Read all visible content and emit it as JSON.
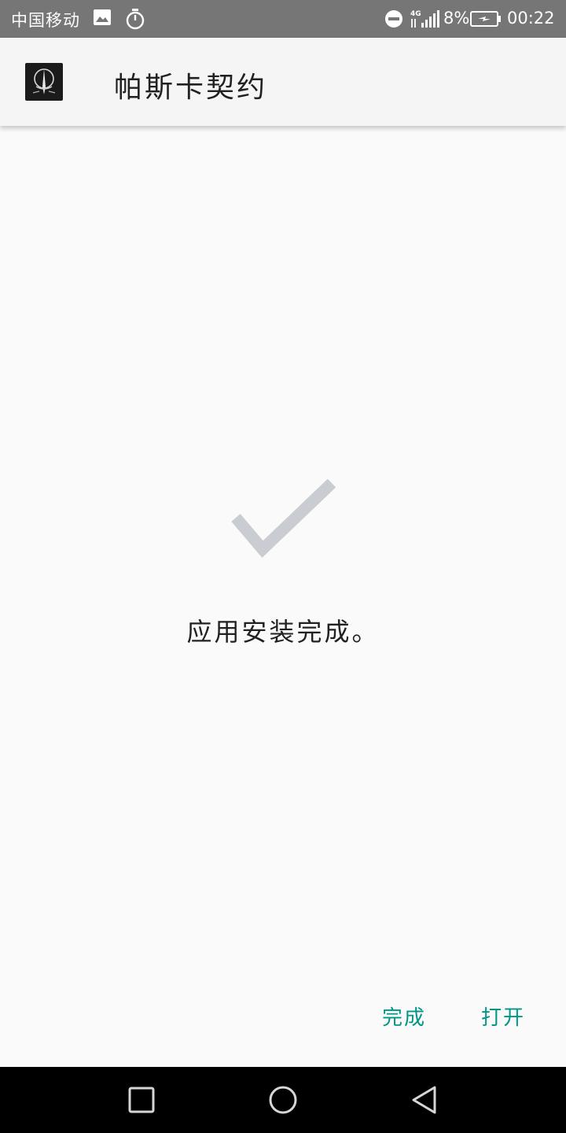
{
  "status_bar": {
    "carrier": "中国移动",
    "network": "4G",
    "battery_percent": "8%",
    "time": "00:22",
    "icons": [
      "image-icon",
      "timer-icon",
      "do-not-disturb-icon",
      "signal-icon",
      "battery-charging-icon"
    ]
  },
  "app_bar": {
    "title": "帕斯卡契约",
    "icon": "app-icon"
  },
  "content": {
    "icon": "check-icon",
    "message": "应用安装完成。"
  },
  "actions": {
    "done_label": "完成",
    "open_label": "打开"
  },
  "nav_bar": {
    "icons": [
      "recent-apps-icon",
      "home-icon",
      "back-icon"
    ]
  },
  "colors": {
    "status_bar": "#767676",
    "accent": "#009688",
    "check": "#c9ccd0",
    "background": "#fafafa",
    "nav_bar": "#000000"
  }
}
